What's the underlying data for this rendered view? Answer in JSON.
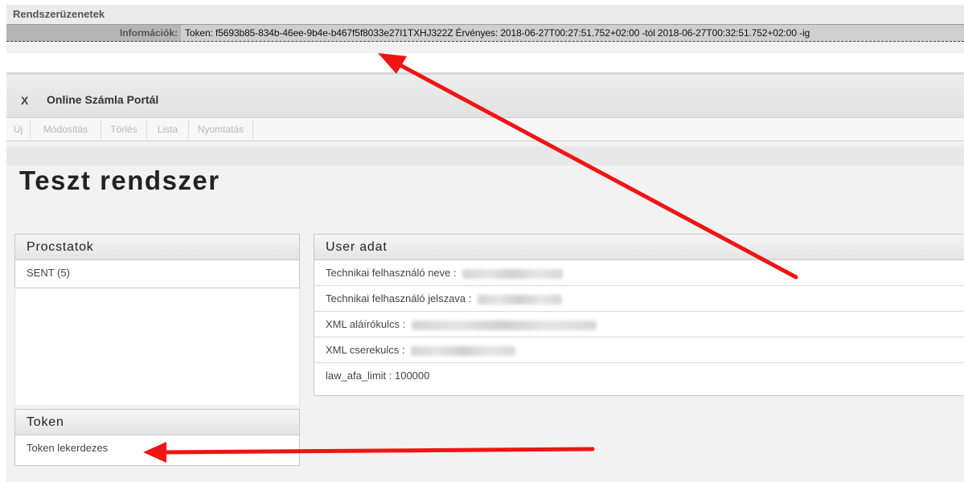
{
  "system_messages": {
    "title": "Rendszerüzenetek",
    "info_label": "Információk:",
    "info_text": "Token: f5693b85-834b-46ee-9b4e-b467f5f8033e27I1TXHJ322Z Érvényes: 2018-06-27T00:27:51.752+02:00 -tól 2018-06-27T00:32:51.752+02:00 -ig"
  },
  "portal": {
    "close_label": "X",
    "title": "Online Számla Portál",
    "toolbar": [
      "Új",
      "Módosítás",
      "Törlés",
      "Lista",
      "Nyomtatás"
    ],
    "page_title": "Teszt rendszer"
  },
  "procstatok": {
    "title": "Procstatok",
    "items": [
      "SENT (5)"
    ]
  },
  "user_adat": {
    "title": "User adat",
    "rows": [
      {
        "label": "Technikai felhasználó neve :",
        "value": ""
      },
      {
        "label": "Technikai felhasználó jelszava :",
        "value": ""
      },
      {
        "label": "XML aláírókulcs :",
        "value": ""
      },
      {
        "label": "XML cserekulcs :",
        "value": ""
      },
      {
        "label": "law_afa_limit : 100000",
        "value": ""
      }
    ]
  },
  "token": {
    "title": "Token",
    "items": [
      "Token lekerdezes"
    ]
  },
  "colors": {
    "annotation_arrow": "#f01414"
  }
}
